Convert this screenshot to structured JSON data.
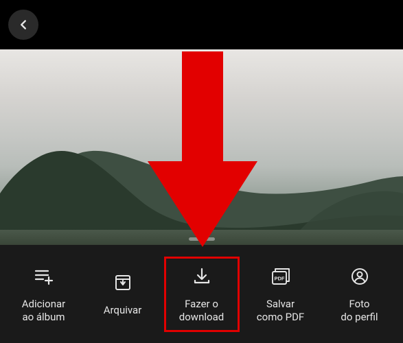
{
  "actions": {
    "addToAlbum": {
      "label": "Adicionar\nao álbum"
    },
    "archive": {
      "label": "Arquivar"
    },
    "download": {
      "label": "Fazer o\ndownload"
    },
    "savePdf": {
      "label": "Salvar\ncomo PDF"
    },
    "profilePhoto": {
      "label": "Foto\ndo perfil"
    }
  },
  "annotation": {
    "color": "#e20000"
  }
}
